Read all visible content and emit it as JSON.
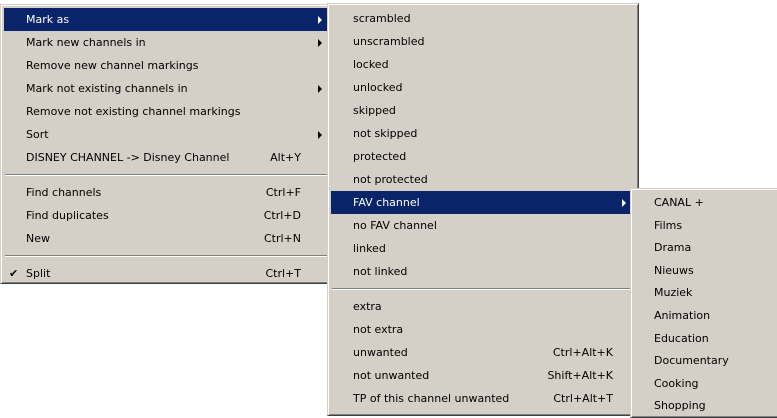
{
  "main_menu": {
    "groups": [
      [
        {
          "label": "Mark as",
          "shortcut": "",
          "submenu": true,
          "selected": true,
          "checked": false
        },
        {
          "label": "Mark new channels in",
          "shortcut": "",
          "submenu": true,
          "selected": false,
          "checked": false
        },
        {
          "label": "Remove new channel markings",
          "shortcut": "",
          "submenu": false,
          "selected": false,
          "checked": false
        },
        {
          "label": "Mark not existing channels in",
          "shortcut": "",
          "submenu": true,
          "selected": false,
          "checked": false
        },
        {
          "label": "Remove not existing channel markings",
          "shortcut": "",
          "submenu": false,
          "selected": false,
          "checked": false
        },
        {
          "label": "Sort",
          "shortcut": "",
          "submenu": true,
          "selected": false,
          "checked": false
        },
        {
          "label": "DISNEY CHANNEL -> Disney Channel",
          "shortcut": "Alt+Y",
          "submenu": false,
          "selected": false,
          "checked": false
        }
      ],
      [
        {
          "label": "Find channels",
          "shortcut": "Ctrl+F",
          "submenu": false,
          "selected": false,
          "checked": false
        },
        {
          "label": "Find duplicates",
          "shortcut": "Ctrl+D",
          "submenu": false,
          "selected": false,
          "checked": false
        },
        {
          "label": "New",
          "shortcut": "Ctrl+N",
          "submenu": false,
          "selected": false,
          "checked": false
        }
      ],
      [
        {
          "label": "Split",
          "shortcut": "Ctrl+T",
          "submenu": false,
          "selected": false,
          "checked": true
        }
      ]
    ]
  },
  "mark_as_menu": {
    "groups": [
      [
        {
          "label": "scrambled",
          "shortcut": "",
          "submenu": false,
          "selected": false
        },
        {
          "label": "unscrambled",
          "shortcut": "",
          "submenu": false,
          "selected": false
        },
        {
          "label": "locked",
          "shortcut": "",
          "submenu": false,
          "selected": false
        },
        {
          "label": "unlocked",
          "shortcut": "",
          "submenu": false,
          "selected": false
        },
        {
          "label": "skipped",
          "shortcut": "",
          "submenu": false,
          "selected": false
        },
        {
          "label": "not skipped",
          "shortcut": "",
          "submenu": false,
          "selected": false
        },
        {
          "label": "protected",
          "shortcut": "",
          "submenu": false,
          "selected": false
        },
        {
          "label": "not protected",
          "shortcut": "",
          "submenu": false,
          "selected": false
        },
        {
          "label": "FAV channel",
          "shortcut": "",
          "submenu": true,
          "selected": true
        },
        {
          "label": "no FAV channel",
          "shortcut": "",
          "submenu": false,
          "selected": false
        },
        {
          "label": "linked",
          "shortcut": "",
          "submenu": false,
          "selected": false
        },
        {
          "label": "not linked",
          "shortcut": "",
          "submenu": false,
          "selected": false
        }
      ],
      [
        {
          "label": "extra",
          "shortcut": "",
          "submenu": false,
          "selected": false
        },
        {
          "label": "not extra",
          "shortcut": "",
          "submenu": false,
          "selected": false
        },
        {
          "label": "unwanted",
          "shortcut": "Ctrl+Alt+K",
          "submenu": false,
          "selected": false
        },
        {
          "label": "not unwanted",
          "shortcut": "Shift+Alt+K",
          "submenu": false,
          "selected": false
        },
        {
          "label": "TP of this channel unwanted",
          "shortcut": "Ctrl+Alt+T",
          "submenu": false,
          "selected": false
        }
      ]
    ]
  },
  "fav_menu": {
    "items": [
      "CANAL +",
      "Films",
      "Drama",
      "Nieuws",
      "Muziek",
      "Animation",
      "Education",
      "Documentary",
      "Cooking",
      "Shopping"
    ]
  },
  "glyphs": {
    "check_mark": "✔"
  },
  "colors": {
    "menu_bg": "#d4d0c8",
    "highlight_bg": "#0a246a",
    "highlight_text": "#ffffff"
  }
}
